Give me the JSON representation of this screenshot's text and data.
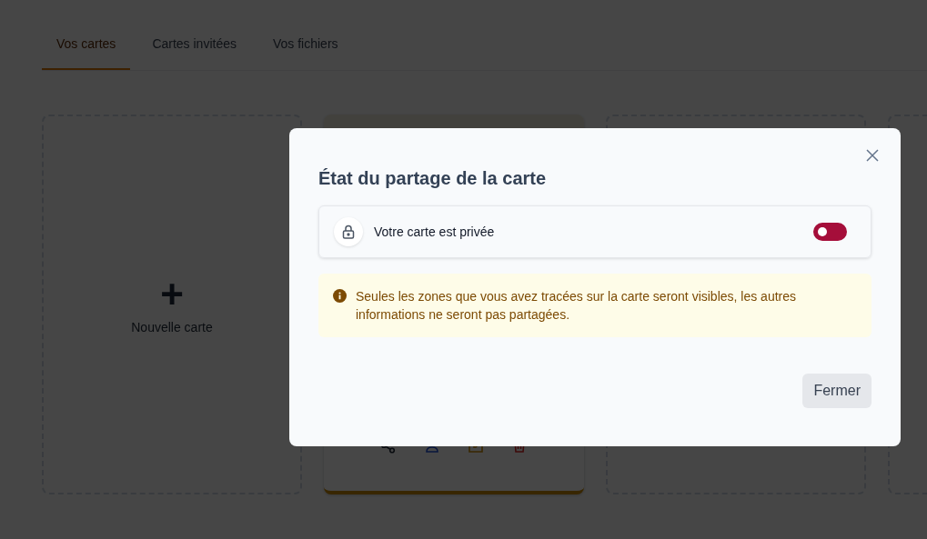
{
  "tabs": [
    {
      "label": "Vos cartes",
      "selected": true
    },
    {
      "label": "Cartes invitées",
      "selected": false
    },
    {
      "label": "Vos fichiers",
      "selected": false
    }
  ],
  "cards": [
    {
      "kind": "new",
      "plus": "+",
      "label": "Nouvelle carte"
    },
    {
      "kind": "map"
    },
    {
      "kind": "empty"
    },
    {
      "kind": "empty"
    }
  ],
  "modal": {
    "title": "État du partage de la carte",
    "status": {
      "label": "Votre carte est privée",
      "on": false
    },
    "notice": "Seules les zones que vous avez tracées sur la carte seront visibles, les autres informations ne seront pas partagées.",
    "close_button": "Fermer"
  }
}
